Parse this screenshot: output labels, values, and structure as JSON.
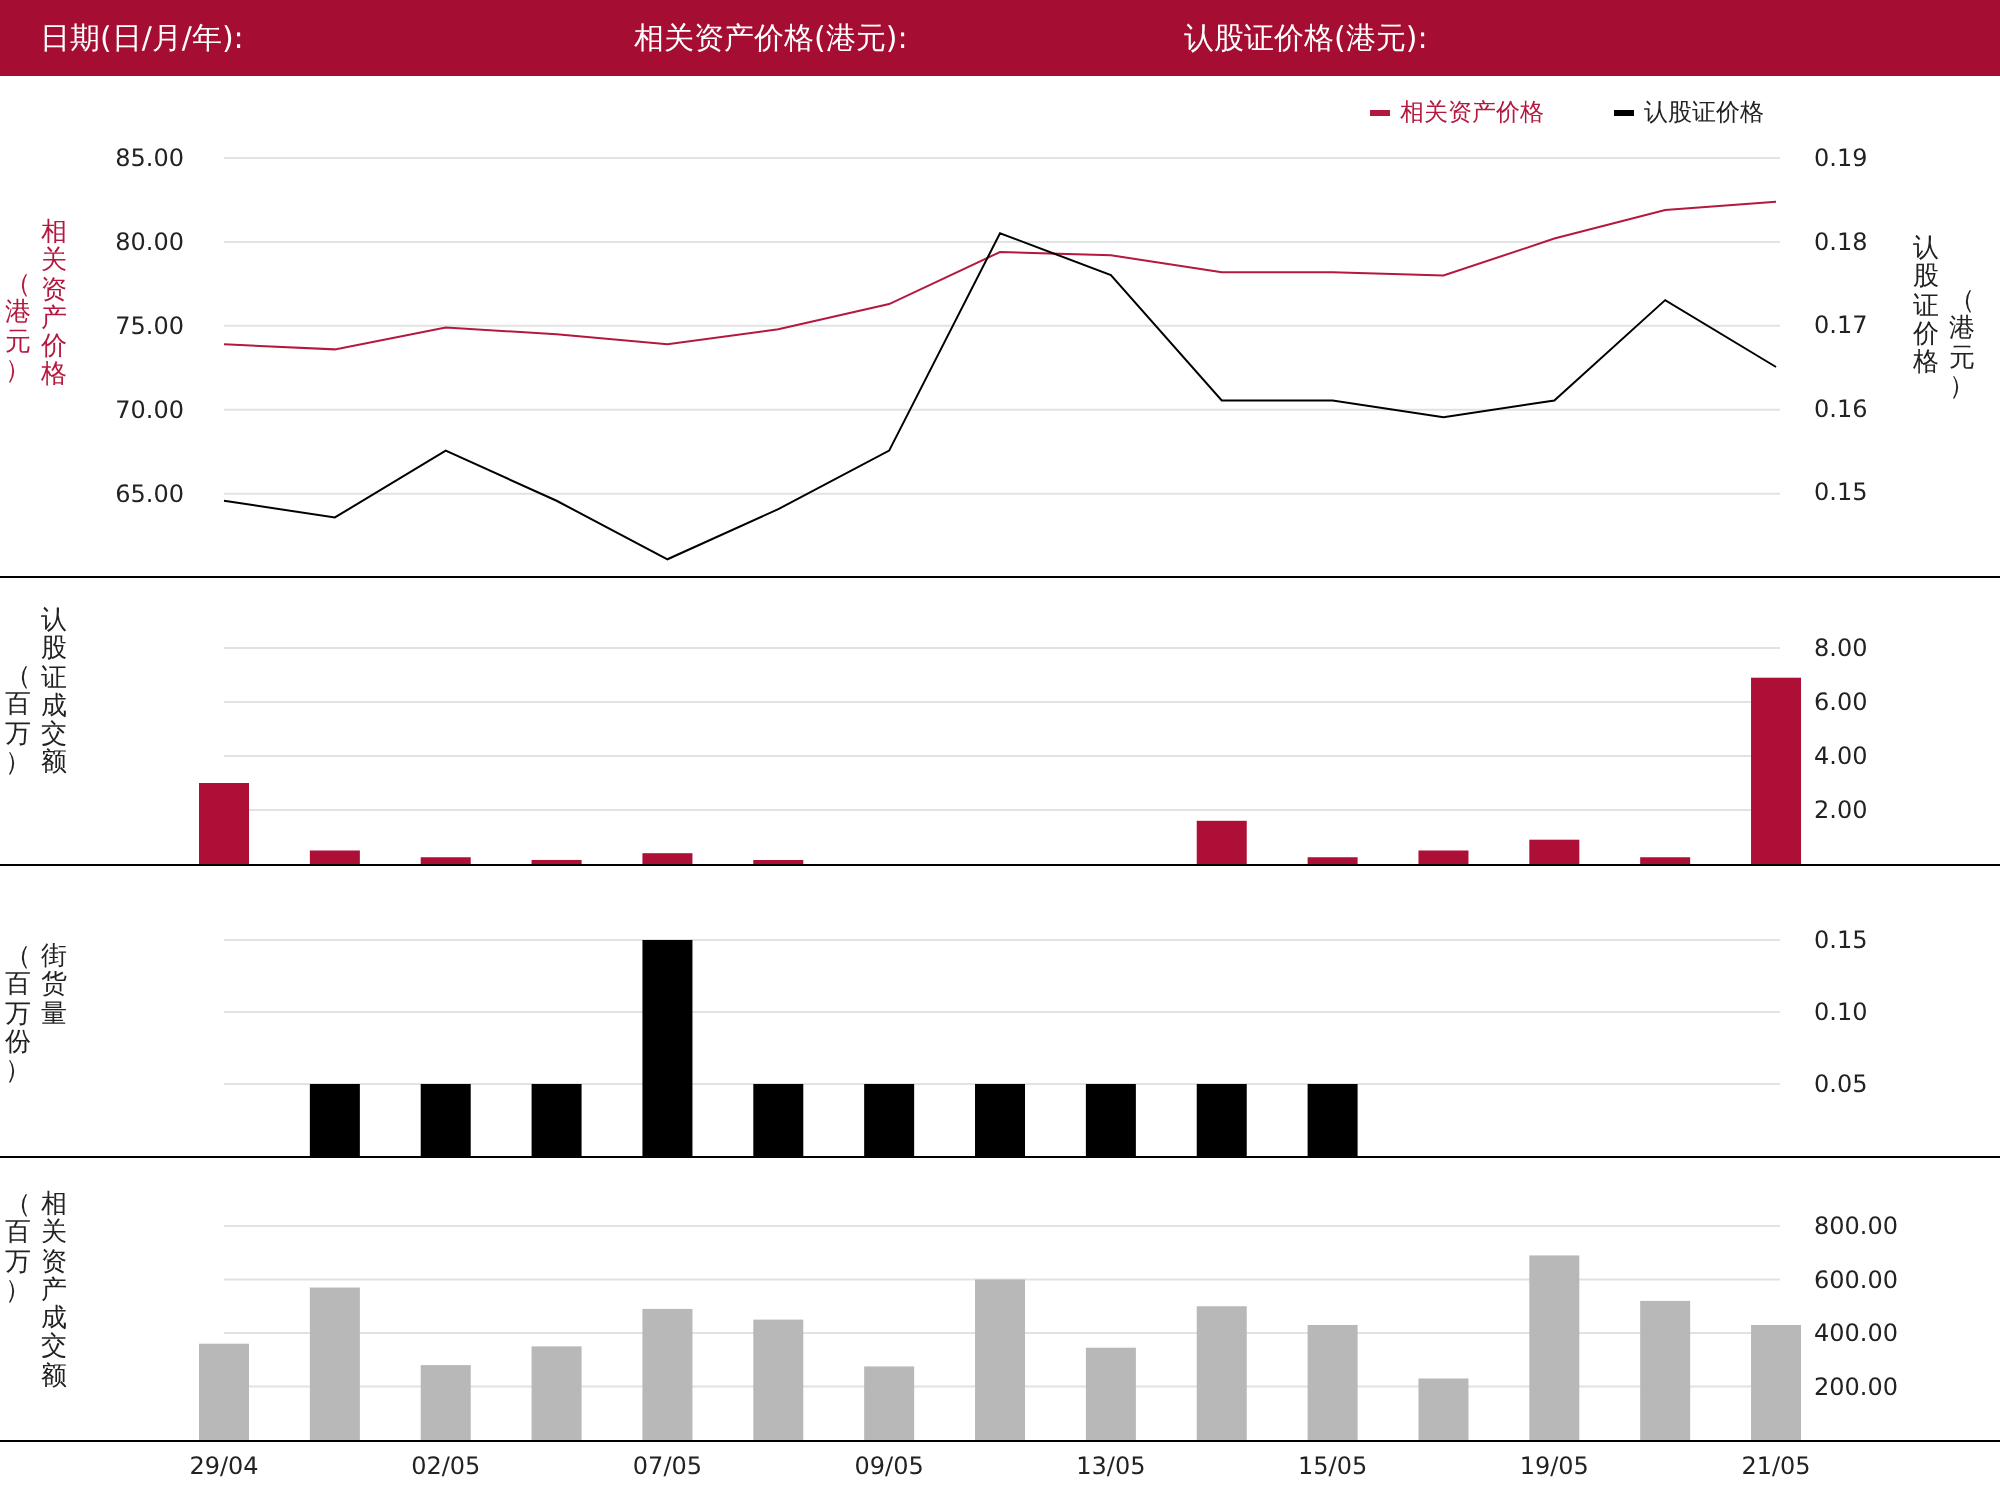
{
  "header": {
    "fields": [
      "日期(日/月/年):",
      "相关资产价格(港元):",
      "认股证价格(港元):"
    ]
  },
  "panels": [
    {
      "y_title": "相关资产价格",
      "y_unit": "（港元）",
      "y2_title": "认股证价格",
      "y2_unit": "（港元）",
      "chart_data": {
        "type": "line",
        "grid": true,
        "legend": true,
        "ylim": [
          60.1,
          85
        ],
        "yticks": [
          {
            "value": 65,
            "label": "65.00"
          },
          {
            "value": 70,
            "label": "70.00"
          },
          {
            "value": 75,
            "label": "75.00"
          },
          {
            "value": 80,
            "label": "80.00"
          },
          {
            "value": 85,
            "label": "85.00"
          }
        ],
        "y2lim": [
          0.14,
          0.19
        ],
        "y2ticks": [
          {
            "value": 0.15,
            "label": "0.15"
          },
          {
            "value": 0.16,
            "label": "0.16"
          },
          {
            "value": 0.17,
            "label": "0.17"
          },
          {
            "value": 0.18,
            "label": "0.18"
          },
          {
            "value": 0.19,
            "label": "0.19"
          }
        ],
        "series": [
          {
            "name": "相关资产价格",
            "color": "#b5183e",
            "axis": "y",
            "values": [
              73.9,
              73.6,
              74.9,
              74.5,
              73.9,
              74.8,
              76.3,
              79.4,
              79.2,
              78.2,
              78.2,
              78.0,
              80.2,
              81.9,
              82.4
            ]
          },
          {
            "name": "认股证价格",
            "color": "#000000",
            "axis": "y2",
            "values": [
              0.149,
              0.147,
              0.155,
              0.149,
              0.142,
              0.148,
              0.155,
              0.181,
              0.176,
              0.161,
              0.161,
              0.159,
              0.161,
              0.173,
              0.165
            ]
          }
        ]
      }
    },
    {
      "y_title": "认股证成交额",
      "y_unit": "（百万）",
      "chart_data": {
        "type": "bar",
        "grid": true,
        "ylim": [
          0,
          8
        ],
        "yticks": [
          {
            "value": 2,
            "label": "2.00"
          },
          {
            "value": 4,
            "label": "4.00"
          },
          {
            "value": 6,
            "label": "6.00"
          },
          {
            "value": 8,
            "label": "8.00"
          }
        ],
        "series": [
          {
            "color": "#ae0f36",
            "values": [
              3.0,
              0.5,
              0.25,
              0.15,
              0.4,
              0.05,
              null,
              null,
              null,
              1.6,
              0.25,
              0.5,
              0.9,
              0.25,
              6.9
            ]
          }
        ]
      }
    },
    {
      "y_title": "街货量",
      "y_unit": "（百万份）",
      "chart_data": {
        "type": "bar",
        "grid": true,
        "ylim": [
          0,
          0.15
        ],
        "yticks": [
          {
            "value": 0.05,
            "label": "0.05"
          },
          {
            "value": 0.1,
            "label": "0.10"
          },
          {
            "value": 0.15,
            "label": "0.15"
          }
        ],
        "series": [
          {
            "color": "#000000",
            "values": [
              null,
              0.05,
              0.05,
              0.05,
              0.15,
              0.05,
              0.05,
              0.05,
              0.05,
              0.05,
              0.05,
              null,
              null,
              null,
              null
            ]
          }
        ]
      }
    },
    {
      "y_title": "相关资产成交额",
      "y_unit": "（百万）",
      "chart_data": {
        "type": "bar",
        "grid": true,
        "categories": [
          "29/04",
          null,
          "02/05",
          null,
          "07/05",
          null,
          "09/05",
          null,
          "13/05",
          null,
          "15/05",
          null,
          "19/05",
          null,
          "21/05"
        ],
        "ylim": [
          0,
          800
        ],
        "yticks": [
          {
            "value": 200,
            "label": "200.00"
          },
          {
            "value": 400,
            "label": "400.00"
          },
          {
            "value": 600,
            "label": "600.00"
          },
          {
            "value": 800,
            "label": "800.00"
          }
        ],
        "series": [
          {
            "color": "#b8b8b8",
            "values": [
              360,
              570,
              280,
              350,
              490,
              450,
              275,
              600,
              345,
              500,
              430,
              230,
              690,
              520,
              430
            ]
          }
        ]
      }
    }
  ]
}
